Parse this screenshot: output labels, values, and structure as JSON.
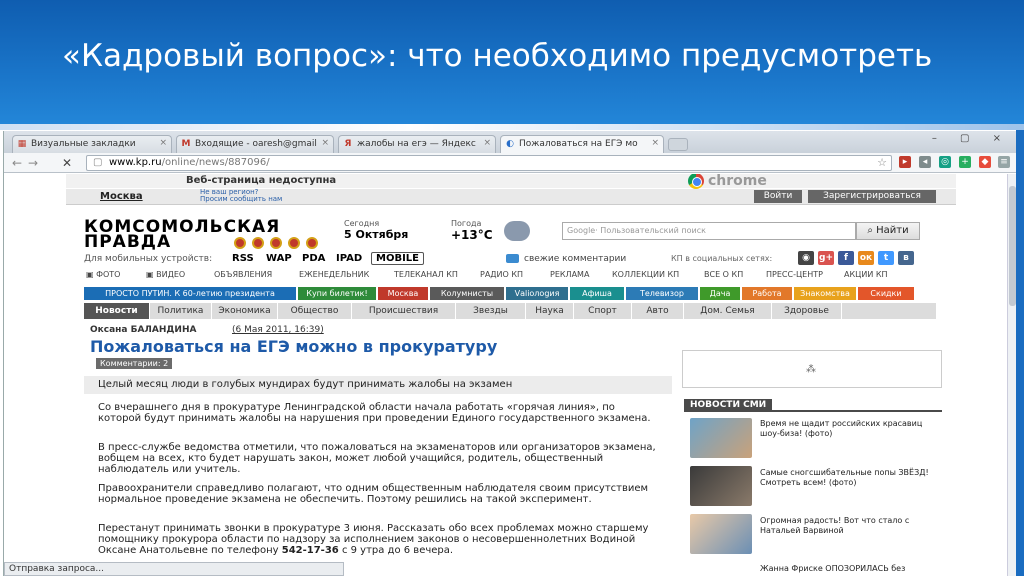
{
  "slide": {
    "title": "«Кадровый вопрос»: что необходимо предусмотреть"
  },
  "browser": {
    "tabs": [
      {
        "label": "Визуальные закладки",
        "icon": "grid-icon",
        "close": "×"
      },
      {
        "label": "Входящие - oaresh@gmail",
        "icon": "gmail-icon",
        "close": "×"
      },
      {
        "label": "жалобы на егэ — Яндекс",
        "icon": "yandex-icon",
        "close": "×"
      },
      {
        "label": "Пожаловаться на ЕГЭ мо",
        "icon": "kp-icon",
        "close": "×"
      }
    ],
    "url_host": "www.kp.ru",
    "url_path": "/online/news/887096/",
    "status_text": "Отправка запроса...",
    "window_controls": "– ▢ ×"
  },
  "page": {
    "error_banner": "Веб-страница недоступна",
    "chrome_word": "chrome",
    "city": "Москва",
    "city_question": "Не ваш регион?",
    "city_question2": "Просим сообщить нам",
    "login": "Войти",
    "register": "Зарегистрироваться",
    "logo_line1": "КОМСОМОЛЬСКАЯ",
    "logo_line2": "ПРАВДА",
    "date_label": "Сегодня",
    "date_value": "5 Октября",
    "weather_label": "Погода",
    "weather_value": "+13°С",
    "search_placeholder": "Google· Пользовательский поиск",
    "search_button": "Найти",
    "mobile_label": "Для мобильных устройств:",
    "mobile_links": [
      "RSS",
      "WAP",
      "PDA",
      "IPAD"
    ],
    "mobile_badge": "MOBILE",
    "fresh_comments": "свежие комментарии",
    "social_label": "КП в социальных сетях:",
    "menu": [
      "ФОТО",
      "ВИДЕО",
      "ОБЪЯВЛЕНИЯ",
      "ЕЖЕНЕДЕЛЬНИК",
      "ТЕЛЕКАНАЛ КП",
      "РАДИО КП",
      "РЕКЛАМА",
      "КОЛЛЕКЦИИ КП",
      "ВСЕ О КП",
      "ПРЕСС-ЦЕНТР",
      "АКЦИИ КП"
    ],
    "rubrics": [
      {
        "label": "ПРОСТО ПУТИН. К 60-летию президента",
        "color": "#1b6db5"
      },
      {
        "label": "Купи билетик!",
        "color": "#2e8b3a"
      },
      {
        "label": "Москва",
        "color": "#c0392b"
      },
      {
        "label": "Колумнисты",
        "color": "#5a5a5a"
      },
      {
        "label": "Vаliолоgия",
        "color": "#2f6f8f"
      },
      {
        "label": "Афиша",
        "color": "#1a8f8f"
      },
      {
        "label": "Телевизор",
        "color": "#2c7bb6"
      },
      {
        "label": "Дача",
        "color": "#3f9a2a"
      },
      {
        "label": "Работа",
        "color": "#e2782a"
      },
      {
        "label": "Знакомства",
        "color": "#e8a21c"
      },
      {
        "label": "Скидки",
        "color": "#e3562a"
      }
    ],
    "sections": [
      "Новости",
      "Политика",
      "Экономика",
      "Общество",
      "Происшествия",
      "Звезды",
      "Наука",
      "Спорт",
      "Авто",
      "Дом. Семья",
      "Здоровье"
    ],
    "author": "Оксана БАЛАНДИНА",
    "pub_date": "(6 Мая 2011, 16:39)",
    "headline": "Пожаловаться на ЕГЭ можно в прокуратуру",
    "comments_badge": "Комментарии: 2",
    "lead": "Целый месяц люди в голубых мундирах будут принимать жалобы на экзамен",
    "paragraphs": [
      "Со вчерашнего дня в прокуратуре Ленинградской области начала работать «горячая линия», по которой будут принимать жалобы на нарушения при проведении Единого государственного экзамена.",
      "В пресс-службе ведомства отметили, что пожаловаться на экзаменаторов или организаторов экзамена, вобщем на всех, кто будет нарушать закон, может любой учащийся, родитель, общественный наблюдатель или учитель.",
      "Правоохранители справедливо полагают, что одним общественным наблюдателя своим присутствием нормальное проведение экзамена не обеспечить. Поэтому решились на такой эксперимент.",
      "Перестанут принимать звонки в прокуратуре 3 июня. Рассказать обо всех проблемах можно старшему помощнику прокурора области по надзору за исполнением законов о несовершеннолетних Водиной Оксане Анатольевне по телефону"
    ],
    "phone": "542-17-36",
    "para4_tail": "с 9 утра до 6 вечера.",
    "news_smi_title": "НОВОСТИ СМИ",
    "news_items": [
      "Время не щадит российских красавиц шоу-биза! (фото)",
      "Самые сногсшибательные попы ЗВЁЗД! Смотреть всем! (фото)",
      "Огромная радость! Вот что стало с Натальей Варвиной",
      "Жанна Фриске ОПОЗОРИЛАСЬ без"
    ]
  }
}
